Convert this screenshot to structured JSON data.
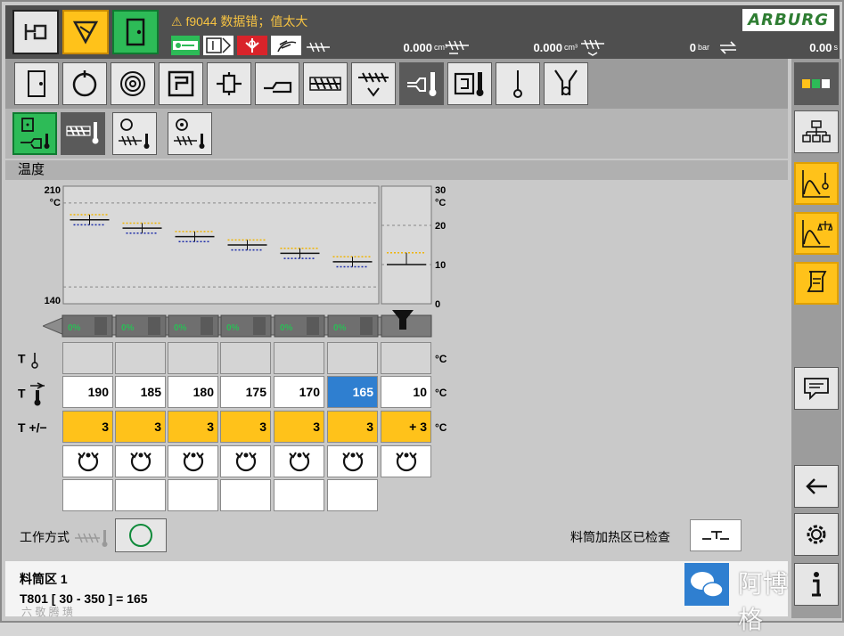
{
  "alarm": {
    "text": "f9044 数据错；值太大",
    "icon": "warning-triangle-icon"
  },
  "brand": "ARBURG",
  "readouts": [
    {
      "value": "0.000",
      "unit": "cm³"
    },
    {
      "value": "0.000",
      "unit": "cm³"
    },
    {
      "value": "0",
      "unit": "bar"
    },
    {
      "value": "0.00",
      "unit": "s"
    }
  ],
  "section_title": "温度",
  "chart_data": {
    "type": "range",
    "zones": [
      "1",
      "2",
      "3",
      "4",
      "5",
      "6"
    ],
    "left_axis": {
      "ticks": [
        "210",
        "140"
      ],
      "unit": "°C",
      "ylim": [
        140,
        210
      ]
    },
    "right_axis": {
      "ticks": [
        "30",
        "20",
        "10",
        "0"
      ],
      "unit": "°C",
      "ylim": [
        0,
        30
      ]
    },
    "setpoints": [
      190,
      185,
      180,
      175,
      170,
      165
    ],
    "feed_setpoint": 10,
    "tolerance": [
      3,
      3,
      3,
      3,
      3,
      3
    ],
    "feed_tolerance": 3,
    "nozzle_labels": [
      "0%",
      "0%",
      "0%",
      "0%",
      "0%",
      "0%"
    ]
  },
  "row_labels": {
    "actual": "T",
    "set": "T",
    "tol": "T +/−"
  },
  "units": {
    "actual": "°C",
    "set": "°C",
    "tol": "°C"
  },
  "set_values": [
    "190",
    "185",
    "180",
    "175",
    "170",
    "165",
    "10"
  ],
  "tol_values": [
    "3",
    "3",
    "3",
    "3",
    "3",
    "3",
    "+ 3"
  ],
  "mode_label": "工作方式",
  "barrel_checked_label": "料筒加热区已检查",
  "status": {
    "line1": "料筒区 1",
    "line2": "T801 [ 30 - 350 ] = 165"
  },
  "watermark": {
    "left": "六 敬 腾 璜",
    "right": "阿博格"
  }
}
